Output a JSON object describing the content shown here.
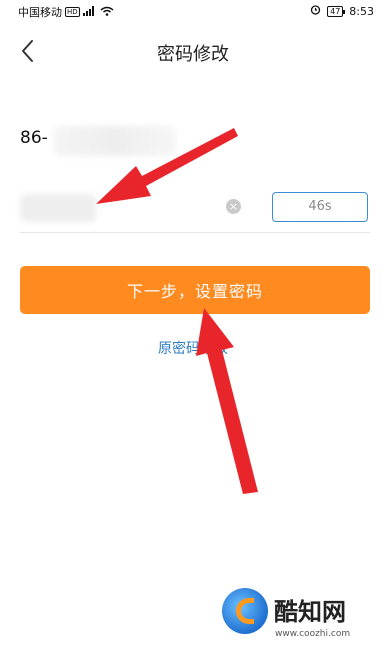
{
  "status_bar": {
    "carrier": "中国移动",
    "hd_badge": "HD",
    "battery": "47",
    "time": "8:53"
  },
  "header": {
    "back_icon": "chevron-left-icon",
    "title": "密码修改"
  },
  "phone": {
    "prefix": "86-"
  },
  "verification": {
    "clear_icon": "close-circle-icon",
    "countdown": "46s"
  },
  "actions": {
    "next_label": "下一步，设置密码",
    "old_password_link": "原密码修改"
  },
  "watermark": {
    "name": "酷知网",
    "url": "www.coozhi.com"
  },
  "colors": {
    "primary_button": "#ff8a1f",
    "link": "#2f7fc7",
    "countdown_border": "#3a8ed6",
    "annotation_arrow": "#e8252a"
  }
}
